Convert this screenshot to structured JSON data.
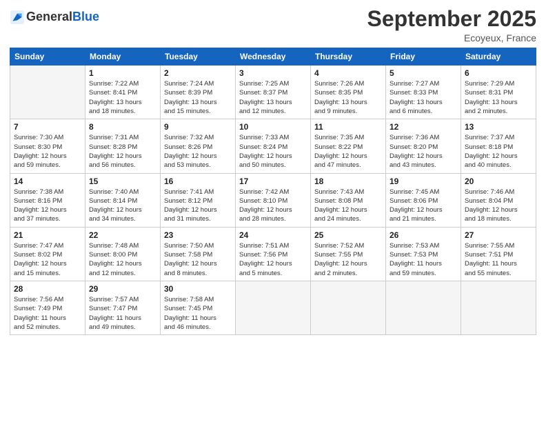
{
  "header": {
    "logo_line1": "General",
    "logo_line2": "Blue",
    "month": "September 2025",
    "location": "Ecoyeux, France"
  },
  "weekdays": [
    "Sunday",
    "Monday",
    "Tuesday",
    "Wednesday",
    "Thursday",
    "Friday",
    "Saturday"
  ],
  "weeks": [
    [
      {
        "day": "",
        "info": ""
      },
      {
        "day": "1",
        "info": "Sunrise: 7:22 AM\nSunset: 8:41 PM\nDaylight: 13 hours\nand 18 minutes."
      },
      {
        "day": "2",
        "info": "Sunrise: 7:24 AM\nSunset: 8:39 PM\nDaylight: 13 hours\nand 15 minutes."
      },
      {
        "day": "3",
        "info": "Sunrise: 7:25 AM\nSunset: 8:37 PM\nDaylight: 13 hours\nand 12 minutes."
      },
      {
        "day": "4",
        "info": "Sunrise: 7:26 AM\nSunset: 8:35 PM\nDaylight: 13 hours\nand 9 minutes."
      },
      {
        "day": "5",
        "info": "Sunrise: 7:27 AM\nSunset: 8:33 PM\nDaylight: 13 hours\nand 6 minutes."
      },
      {
        "day": "6",
        "info": "Sunrise: 7:29 AM\nSunset: 8:31 PM\nDaylight: 13 hours\nand 2 minutes."
      }
    ],
    [
      {
        "day": "7",
        "info": "Sunrise: 7:30 AM\nSunset: 8:30 PM\nDaylight: 12 hours\nand 59 minutes."
      },
      {
        "day": "8",
        "info": "Sunrise: 7:31 AM\nSunset: 8:28 PM\nDaylight: 12 hours\nand 56 minutes."
      },
      {
        "day": "9",
        "info": "Sunrise: 7:32 AM\nSunset: 8:26 PM\nDaylight: 12 hours\nand 53 minutes."
      },
      {
        "day": "10",
        "info": "Sunrise: 7:33 AM\nSunset: 8:24 PM\nDaylight: 12 hours\nand 50 minutes."
      },
      {
        "day": "11",
        "info": "Sunrise: 7:35 AM\nSunset: 8:22 PM\nDaylight: 12 hours\nand 47 minutes."
      },
      {
        "day": "12",
        "info": "Sunrise: 7:36 AM\nSunset: 8:20 PM\nDaylight: 12 hours\nand 43 minutes."
      },
      {
        "day": "13",
        "info": "Sunrise: 7:37 AM\nSunset: 8:18 PM\nDaylight: 12 hours\nand 40 minutes."
      }
    ],
    [
      {
        "day": "14",
        "info": "Sunrise: 7:38 AM\nSunset: 8:16 PM\nDaylight: 12 hours\nand 37 minutes."
      },
      {
        "day": "15",
        "info": "Sunrise: 7:40 AM\nSunset: 8:14 PM\nDaylight: 12 hours\nand 34 minutes."
      },
      {
        "day": "16",
        "info": "Sunrise: 7:41 AM\nSunset: 8:12 PM\nDaylight: 12 hours\nand 31 minutes."
      },
      {
        "day": "17",
        "info": "Sunrise: 7:42 AM\nSunset: 8:10 PM\nDaylight: 12 hours\nand 28 minutes."
      },
      {
        "day": "18",
        "info": "Sunrise: 7:43 AM\nSunset: 8:08 PM\nDaylight: 12 hours\nand 24 minutes."
      },
      {
        "day": "19",
        "info": "Sunrise: 7:45 AM\nSunset: 8:06 PM\nDaylight: 12 hours\nand 21 minutes."
      },
      {
        "day": "20",
        "info": "Sunrise: 7:46 AM\nSunset: 8:04 PM\nDaylight: 12 hours\nand 18 minutes."
      }
    ],
    [
      {
        "day": "21",
        "info": "Sunrise: 7:47 AM\nSunset: 8:02 PM\nDaylight: 12 hours\nand 15 minutes."
      },
      {
        "day": "22",
        "info": "Sunrise: 7:48 AM\nSunset: 8:00 PM\nDaylight: 12 hours\nand 12 minutes."
      },
      {
        "day": "23",
        "info": "Sunrise: 7:50 AM\nSunset: 7:58 PM\nDaylight: 12 hours\nand 8 minutes."
      },
      {
        "day": "24",
        "info": "Sunrise: 7:51 AM\nSunset: 7:56 PM\nDaylight: 12 hours\nand 5 minutes."
      },
      {
        "day": "25",
        "info": "Sunrise: 7:52 AM\nSunset: 7:55 PM\nDaylight: 12 hours\nand 2 minutes."
      },
      {
        "day": "26",
        "info": "Sunrise: 7:53 AM\nSunset: 7:53 PM\nDaylight: 11 hours\nand 59 minutes."
      },
      {
        "day": "27",
        "info": "Sunrise: 7:55 AM\nSunset: 7:51 PM\nDaylight: 11 hours\nand 55 minutes."
      }
    ],
    [
      {
        "day": "28",
        "info": "Sunrise: 7:56 AM\nSunset: 7:49 PM\nDaylight: 11 hours\nand 52 minutes."
      },
      {
        "day": "29",
        "info": "Sunrise: 7:57 AM\nSunset: 7:47 PM\nDaylight: 11 hours\nand 49 minutes."
      },
      {
        "day": "30",
        "info": "Sunrise: 7:58 AM\nSunset: 7:45 PM\nDaylight: 11 hours\nand 46 minutes."
      },
      {
        "day": "",
        "info": ""
      },
      {
        "day": "",
        "info": ""
      },
      {
        "day": "",
        "info": ""
      },
      {
        "day": "",
        "info": ""
      }
    ]
  ]
}
